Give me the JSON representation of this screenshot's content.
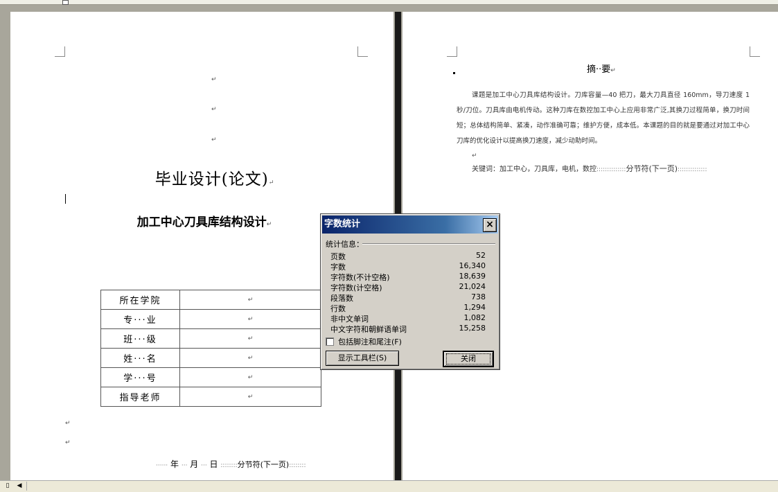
{
  "document": {
    "cover_title": "毕业设计(论文)",
    "cover_subtitle": "加工中心刀具库结构设计",
    "paragraph_mark": "↵",
    "info_table": [
      {
        "label": "所在学院",
        "value": "↵"
      },
      {
        "label": "专···业",
        "value": "↵"
      },
      {
        "label": "班···级",
        "value": "↵"
      },
      {
        "label": "姓···名",
        "value": "↵"
      },
      {
        "label": "学···号",
        "value": "↵"
      },
      {
        "label": "指导老师",
        "value": "↵"
      }
    ],
    "date_line": {
      "dots": "······",
      "year": "年",
      "mid_dots": "···",
      "month": "月",
      "day": "日",
      "section_break": "分节符(下一页)"
    },
    "abstract_title": "摘··要",
    "abstract_body": "课题是加工中心刀具库结构设计。刀库容量—40 把刀，最大刀具直径 160mm，导刀速度 1 秒/刀位。刀具库由电机传动。这种刀库在数控加工中心上应用非常广泛,其换刀过程简单，换刀时间短；总体结构简单、紧凑，动作准确可靠；维护方便，成本低。本课题的目的就是要通过对加工中心刀库的优化设计以提高换刀速度，减少动助时间。",
    "keywords": "关键词：加工中心，刀具库，电机，数控",
    "section_break": "分节符(下一页)"
  },
  "dialog": {
    "title": "字数统计",
    "close_icon": "×",
    "group_label": "统计信息：",
    "stats": [
      {
        "label": "页数",
        "value": "52"
      },
      {
        "label": "字数",
        "value": "16,340"
      },
      {
        "label": "字符数(不计空格)",
        "value": "18,639"
      },
      {
        "label": "字符数(计空格)",
        "value": "21,024"
      },
      {
        "label": "段落数",
        "value": "738"
      },
      {
        "label": "行数",
        "value": "1,294"
      },
      {
        "label": "非中文单词",
        "value": "1,082"
      },
      {
        "label": "中文字符和朝鲜语单词",
        "value": "15,258"
      }
    ],
    "checkbox_label": "包括脚注和尾注(F)",
    "toolbar_button": "显示工具栏(S)",
    "close_button": "关闭"
  }
}
